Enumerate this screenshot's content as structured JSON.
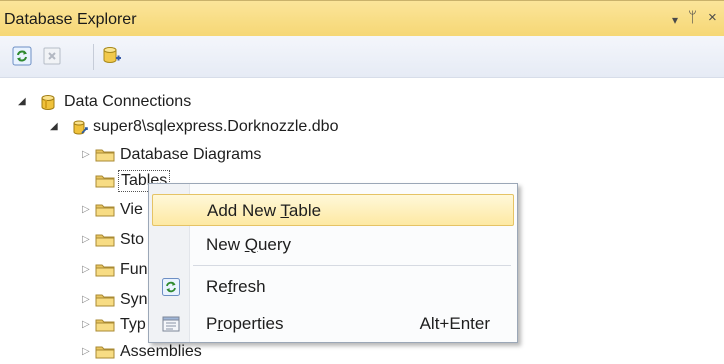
{
  "panel": {
    "title": "Database Explorer",
    "controls": {
      "dropdown": "▾",
      "pin": "ᛘ",
      "close": "×"
    }
  },
  "toolbar": {
    "buttons": [
      {
        "name": "refresh-icon"
      },
      {
        "name": "stop-icon"
      },
      {
        "name": "connect-to-database-icon"
      }
    ]
  },
  "tree": {
    "root": {
      "label": "Data Connections",
      "icon": "database-cylinder-icon",
      "expanded": true
    },
    "connection": {
      "label": "super8\\sqlexpress.Dorknozzle.dbo",
      "icon": "database-connection-icon",
      "expanded": true
    },
    "nodes": [
      {
        "label": "Database Diagrams"
      },
      {
        "label": "Tables"
      },
      {
        "label": "Vie"
      },
      {
        "label": "Sto"
      },
      {
        "label": "Fun"
      },
      {
        "label": "Syn"
      },
      {
        "label": "Typ"
      },
      {
        "label": "Assemblies"
      }
    ]
  },
  "context_menu": {
    "items": [
      {
        "label": "Add New Table",
        "mnemonic": "T",
        "shortcut": "",
        "icon": "",
        "highlighted": true
      },
      {
        "label": "New Query",
        "mnemonic": "Q",
        "shortcut": "",
        "icon": ""
      },
      {
        "label": "Refresh",
        "mnemonic": "f",
        "shortcut": "",
        "icon": "refresh-icon"
      },
      {
        "label": "Properties",
        "mnemonic": "r",
        "shortcut": "Alt+Enter",
        "icon": "properties-icon"
      }
    ]
  }
}
